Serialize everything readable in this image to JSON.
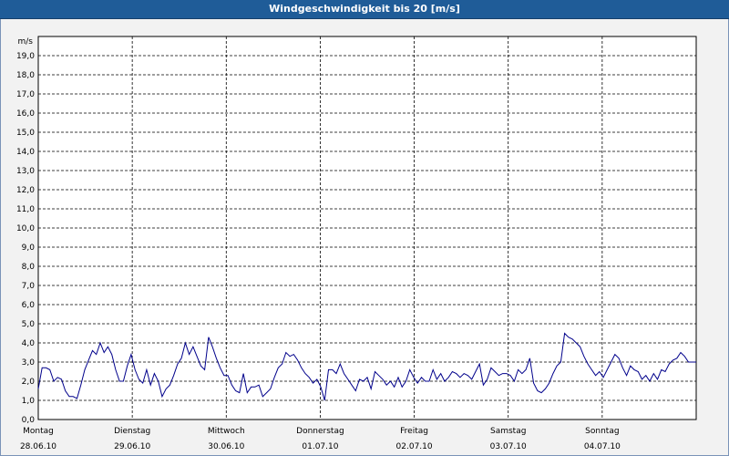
{
  "window": {
    "title": "Windgeschwindigkeit bis 20 [m/s]"
  },
  "chart_data": {
    "type": "line",
    "title": "Windgeschwindigkeit bis 20 [m/s]",
    "ylabel": "m/s",
    "xlabel": "",
    "ylim": [
      0,
      20
    ],
    "grid": true,
    "y_ticks": [
      "0,0",
      "1,0",
      "2,0",
      "3,0",
      "4,0",
      "5,0",
      "6,0",
      "7,0",
      "8,0",
      "9,0",
      "10,0",
      "11,0",
      "12,0",
      "13,0",
      "14,0",
      "15,0",
      "16,0",
      "17,0",
      "18,0",
      "19,0"
    ],
    "x_labels": [
      {
        "day": "Montag",
        "date": "28.06.10"
      },
      {
        "day": "Dienstag",
        "date": "29.06.10"
      },
      {
        "day": "Mittwoch",
        "date": "30.06.10"
      },
      {
        "day": "Donnerstag",
        "date": "01.07.10"
      },
      {
        "day": "Freitag",
        "date": "02.07.10"
      },
      {
        "day": "Samstag",
        "date": "03.07.10"
      },
      {
        "day": "Sonntag",
        "date": "04.07.10"
      }
    ],
    "series": [
      {
        "color": "#00008b",
        "values": [
          1.6,
          2.7,
          2.7,
          2.6,
          2.0,
          2.2,
          2.1,
          1.5,
          1.2,
          1.2,
          1.1,
          1.8,
          2.6,
          3.1,
          3.6,
          3.4,
          4.0,
          3.5,
          3.8,
          3.4,
          2.6,
          2.0,
          2.0,
          2.8,
          3.4,
          2.6,
          2.1,
          1.9,
          2.6,
          1.8,
          2.4,
          2.0,
          1.2,
          1.6,
          1.8,
          2.3,
          2.9,
          3.2,
          4.0,
          3.4,
          3.8,
          3.3,
          2.8,
          2.6,
          4.3,
          3.8,
          3.2,
          2.7,
          2.3,
          2.3,
          1.8,
          1.5,
          1.4,
          2.4,
          1.4,
          1.7,
          1.7,
          1.8,
          1.2,
          1.4,
          1.6,
          2.2,
          2.7,
          2.9,
          3.5,
          3.3,
          3.4,
          3.1,
          2.7,
          2.4,
          2.2,
          1.9,
          2.1,
          1.7,
          1.0,
          2.6,
          2.6,
          2.4,
          2.9,
          2.4,
          2.1,
          1.8,
          1.5,
          2.1,
          2.0,
          2.2,
          1.6,
          2.5,
          2.3,
          2.1,
          1.8,
          2.0,
          1.7,
          2.2,
          1.7,
          2.0,
          2.6,
          2.2,
          1.9,
          2.2,
          2.0,
          2.0,
          2.6,
          2.1,
          2.4,
          2.0,
          2.2,
          2.5,
          2.4,
          2.2,
          2.4,
          2.3,
          2.1,
          2.5,
          2.9,
          1.8,
          2.1,
          2.7,
          2.5,
          2.3,
          2.4,
          2.4,
          2.3,
          2.0,
          2.6,
          2.4,
          2.6,
          3.2,
          1.9,
          1.5,
          1.4,
          1.6,
          1.9,
          2.4,
          2.8,
          3.0,
          4.5,
          4.3,
          4.2,
          4.0,
          3.8,
          3.3,
          2.9,
          2.6,
          2.3,
          2.5,
          2.2,
          2.6,
          3.0,
          3.4,
          3.2,
          2.7,
          2.3,
          2.8,
          2.6,
          2.5,
          2.1,
          2.3,
          2.0,
          2.4,
          2.1,
          2.6,
          2.5,
          2.9,
          3.1,
          3.2,
          3.5,
          3.3,
          3.0,
          3.0,
          3.0
        ]
      }
    ]
  }
}
